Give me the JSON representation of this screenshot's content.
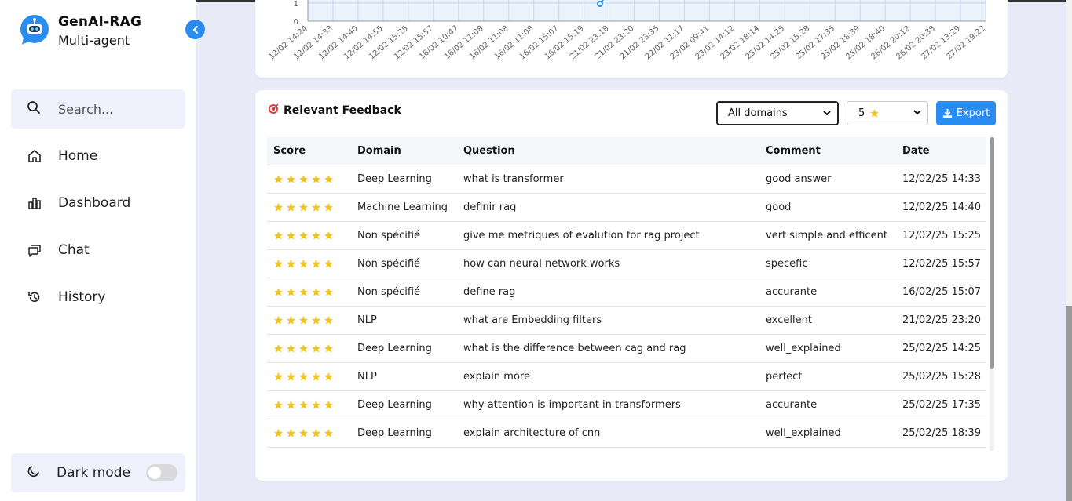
{
  "brand": {
    "title": "GenAI-RAG",
    "subtitle": "Multi-agent"
  },
  "search": {
    "placeholder": "Search..."
  },
  "nav": [
    {
      "label": "Home",
      "icon": "home-icon"
    },
    {
      "label": "Dashboard",
      "icon": "bar-chart-icon"
    },
    {
      "label": "Chat",
      "icon": "chat-icon"
    },
    {
      "label": "History",
      "icon": "history-icon"
    }
  ],
  "darkmode": {
    "label": "Dark mode",
    "enabled": false
  },
  "chart_data": {
    "type": "line",
    "x": [
      "12/02 14:24",
      "12/02 14:33",
      "12/02 14:40",
      "12/02 14:55",
      "12/02 15:25",
      "12/02 15:57",
      "16/02 10:47",
      "16/02 11:08",
      "16/02 11:08",
      "16/02 11:08",
      "16/02 15:07",
      "16/02 15:19",
      "21/02 23:18",
      "21/02 23:20",
      "21/02 23:35",
      "22/02 11:17",
      "23/02 09:41",
      "23/02 14:12",
      "23/02 18:14",
      "25/02 14:25",
      "25/02 15:28",
      "25/02 17:35",
      "25/02 18:39",
      "25/02 18:40",
      "26/02 20:12",
      "26/02 20:38",
      "27/02 13:29",
      "27/02 19:22"
    ],
    "yticks": [
      "1",
      "0"
    ],
    "ylim": [
      0,
      1
    ],
    "grid": true,
    "color": "#2b8cf0"
  },
  "feedback": {
    "title": "Relevant Feedback",
    "domain_filter": "All domains",
    "rating_filter": "5",
    "export_label": "Export",
    "columns": [
      "Score",
      "Domain",
      "Question",
      "Comment",
      "Date"
    ],
    "rows": [
      {
        "score": 5,
        "domain": "Deep Learning",
        "question": "what is transformer",
        "comment": "good answer",
        "date": "12/02/25 14:33"
      },
      {
        "score": 5,
        "domain": "Machine Learning",
        "question": "definir rag",
        "comment": "good",
        "date": "12/02/25 14:40"
      },
      {
        "score": 5,
        "domain": "Non spécifié",
        "question": "give me metriques of evalution for rag project",
        "comment": "vert simple and efficent",
        "date": "12/02/25 15:25"
      },
      {
        "score": 5,
        "domain": "Non spécifié",
        "question": "how can neural network works",
        "comment": "specefic",
        "date": "12/02/25 15:57"
      },
      {
        "score": 5,
        "domain": "Non spécifié",
        "question": "define rag",
        "comment": "accurante",
        "date": "16/02/25 15:07"
      },
      {
        "score": 5,
        "domain": "NLP",
        "question": "what are Embedding filters",
        "comment": "excellent",
        "date": "21/02/25 23:20"
      },
      {
        "score": 5,
        "domain": "Deep Learning",
        "question": "what is the difference between cag and rag",
        "comment": "well_explained",
        "date": "25/02/25 14:25"
      },
      {
        "score": 5,
        "domain": "NLP",
        "question": "explain more",
        "comment": "perfect",
        "date": "25/02/25 15:28"
      },
      {
        "score": 5,
        "domain": "Deep Learning",
        "question": "why attention is important in transformers",
        "comment": "accurante",
        "date": "25/02/25 17:35"
      },
      {
        "score": 5,
        "domain": "Deep Learning",
        "question": "explain architecture of cnn",
        "comment": "well_explained",
        "date": "25/02/25 18:39"
      }
    ]
  },
  "colors": {
    "accent": "#2b8cf0",
    "star": "#f5c518",
    "background": "#e8ebf7"
  }
}
